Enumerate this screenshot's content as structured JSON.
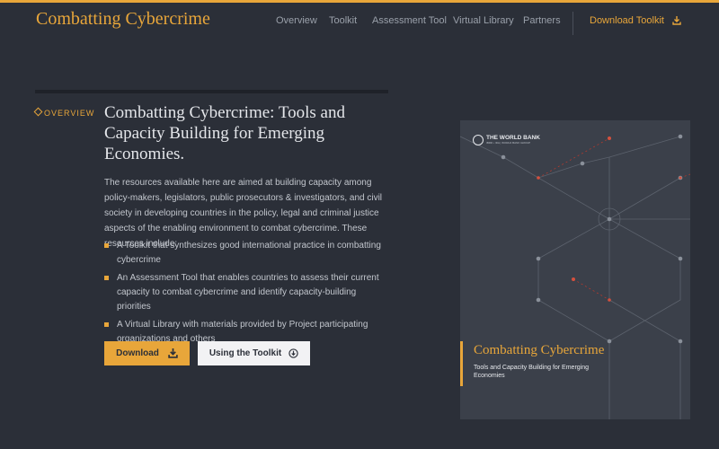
{
  "header": {
    "site_title": "Combatting Cybercrime",
    "nav": [
      "Overview",
      "Toolkit",
      "Assessment Tool",
      "Virtual Library",
      "Partners"
    ],
    "download_toolkit": "Download Toolkit"
  },
  "section": {
    "label": "OVERVIEW",
    "title": "Combatting Cybercrime: Tools and Capacity Building for Emerging Economies.",
    "intro": "The resources available here are aimed at building capacity among policy-makers, legislators, public prosecutors & investigators, and civil society in developing countries in the policy, legal and criminal justice aspects of the enabling environment to combat cybercrime. These resources include:",
    "bullets": [
      "A Toolkit that synthesizes good international practice in combatting cybercrime",
      "An Assessment Tool that enables countries to assess their current capacity to combat cybercrime and identify capacity-building priorities",
      "A Virtual Library with materials provided by Project participating organizations and others"
    ],
    "buttons": {
      "download": "Download",
      "using_toolkit": "Using the Toolkit"
    }
  },
  "cover": {
    "publisher": "THE WORLD BANK",
    "publisher_sub": "IBRD • IDA | WORLD BANK GROUP",
    "title": "Combatting Cybercrime",
    "subtitle": "Tools and Capacity Building for Emerging Economies"
  },
  "colors": {
    "background": "#2b2f38",
    "accent": "#e8a63a",
    "text": "#c2c6cd",
    "cover": "#3b404a"
  },
  "icons": {
    "download": "download-tray-icon",
    "toolkit": "arrow-circle-icon",
    "section": "diamond-icon",
    "logo": "globe-icon"
  }
}
